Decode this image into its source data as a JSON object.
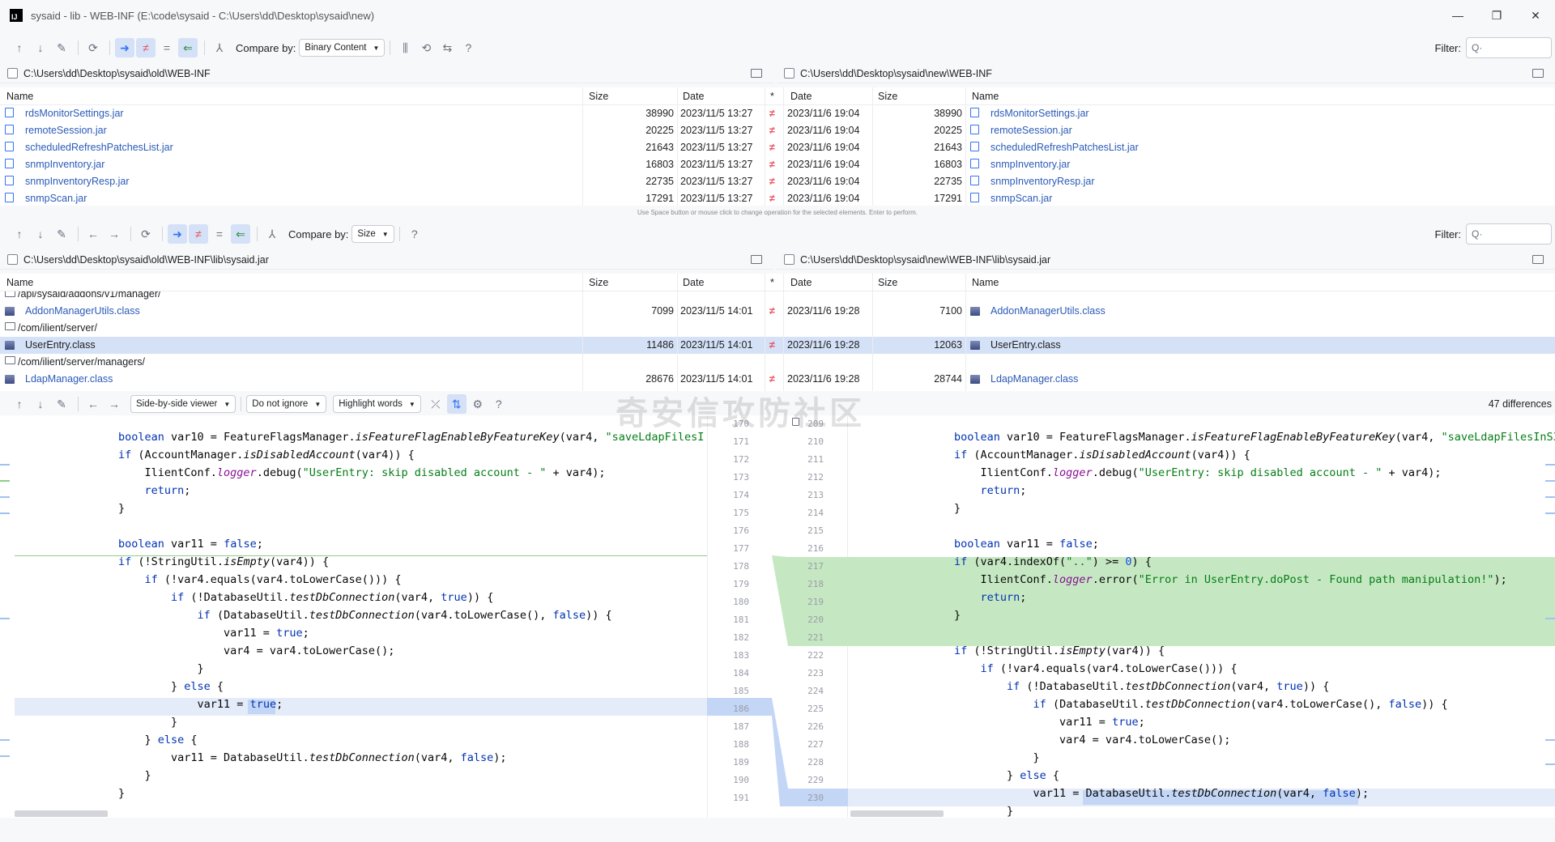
{
  "window": {
    "title": "sysaid - lib - WEB-INF (E:\\code\\sysaid - C:\\Users\\dd\\Desktop\\sysaid\\new)",
    "logo_text": "IJ",
    "minimize_icon": "—",
    "restore_icon": "❐",
    "close_icon": "✕"
  },
  "toolbar1": {
    "compare_label": "Compare by:",
    "compare_value": "Binary Content",
    "filter_label": "Filter:",
    "filter_placeholder": "Q·"
  },
  "toolbar2": {
    "compare_label": "Compare by:",
    "compare_value": "Size",
    "filter_label": "Filter:",
    "filter_placeholder": "Q·"
  },
  "panel1": {
    "left_path": "C:\\Users\\dd\\Desktop\\sysaid\\old\\WEB-INF",
    "right_path": "C:\\Users\\dd\\Desktop\\sysaid\\new\\WEB-INF",
    "headers": {
      "name": "Name",
      "size": "Size",
      "date": "Date",
      "star": "*",
      "date_r": "Date",
      "size_r": "Size",
      "name_r": "Name"
    },
    "rows": [
      {
        "name": "rdsMonitorSettings.jar",
        "size": "38990",
        "date": "2023/11/5 13:27",
        "date_r": "2023/11/6 19:04",
        "size_r": "38990",
        "name_r": "rdsMonitorSettings.jar"
      },
      {
        "name": "remoteSession.jar",
        "size": "20225",
        "date": "2023/11/5 13:27",
        "date_r": "2023/11/6 19:04",
        "size_r": "20225",
        "name_r": "remoteSession.jar"
      },
      {
        "name": "scheduledRefreshPatchesList.jar",
        "size": "21643",
        "date": "2023/11/5 13:27",
        "date_r": "2023/11/6 19:04",
        "size_r": "21643",
        "name_r": "scheduledRefreshPatchesList.jar"
      },
      {
        "name": "snmpInventory.jar",
        "size": "16803",
        "date": "2023/11/5 13:27",
        "date_r": "2023/11/6 19:04",
        "size_r": "16803",
        "name_r": "snmpInventory.jar"
      },
      {
        "name": "snmpInventoryResp.jar",
        "size": "22735",
        "date": "2023/11/5 13:27",
        "date_r": "2023/11/6 19:04",
        "size_r": "22735",
        "name_r": "snmpInventoryResp.jar"
      },
      {
        "name": "snmpScan.jar",
        "size": "17291",
        "date": "2023/11/5 13:27",
        "date_r": "2023/11/6 19:04",
        "size_r": "17291",
        "name_r": "snmpScan.jar"
      }
    ],
    "diff_mark": "≠",
    "hint": "Use Space button or mouse click to change operation for the selected elements. Enter to perform."
  },
  "panel2": {
    "left_path": "C:\\Users\\dd\\Desktop\\sysaid\\old\\WEB-INF\\lib\\sysaid.jar",
    "right_path": "C:\\Users\\dd\\Desktop\\sysaid\\new\\WEB-INF\\lib\\sysaid.jar",
    "headers": {
      "name": "Name",
      "size": "Size",
      "date": "Date",
      "star": "*",
      "date_r": "Date",
      "size_r": "Size",
      "name_r": "Name"
    },
    "folder1": "/api/sysaid/addons/v1/manager/",
    "row1": {
      "name": "AddonManagerUtils.class",
      "size": "7099",
      "date": "2023/11/5 14:01",
      "date_r": "2023/11/6 19:28",
      "size_r": "7100",
      "name_r": "AddonManagerUtils.class"
    },
    "folder2": "/com/ilient/server/",
    "row2": {
      "name": "UserEntry.class",
      "size": "11486",
      "date": "2023/11/5 14:01",
      "date_r": "2023/11/6 19:28",
      "size_r": "12063",
      "name_r": "UserEntry.class"
    },
    "folder3": "/com/ilient/server/managers/",
    "row3": {
      "name": "LdapManager.class",
      "size": "28676",
      "date": "2023/11/5 14:01",
      "date_r": "2023/11/6 19:28",
      "size_r": "28744",
      "name_r": "LdapManager.class"
    },
    "diff_mark": "≠"
  },
  "viewer_toolbar": {
    "viewer_mode": "Side-by-side viewer",
    "ignore": "Do not ignore",
    "highlight": "Highlight words",
    "differences": "47 differences"
  },
  "watermark": "奇安信攻防社区",
  "diff": {
    "left_line_numbers": [
      "170",
      "171",
      "172",
      "173",
      "174",
      "175",
      "176",
      "177",
      "178",
      "179",
      "180",
      "181",
      "182",
      "183",
      "184",
      "185",
      "186",
      "187",
      "188",
      "189",
      "190",
      "191"
    ],
    "right_line_numbers": [
      "209",
      "210",
      "211",
      "212",
      "213",
      "214",
      "215",
      "216",
      "217",
      "218",
      "219",
      "220",
      "221",
      "222",
      "223",
      "224",
      "225",
      "226",
      "227",
      "228",
      "229",
      "230"
    ]
  }
}
